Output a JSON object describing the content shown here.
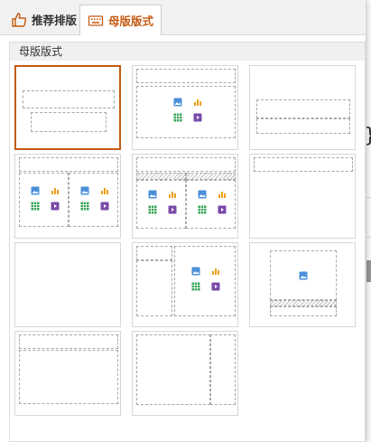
{
  "tabs": [
    {
      "label": "推荐排版",
      "icon": "thumbs-up-icon",
      "active": false
    },
    {
      "label": "母版版式",
      "icon": "keyboard-icon",
      "active": true
    }
  ],
  "section": {
    "title": "母版版式"
  },
  "layouts": [
    {
      "name": "title-slide",
      "selected": true
    },
    {
      "name": "title-and-content",
      "selected": false
    },
    {
      "name": "section-header",
      "selected": false
    },
    {
      "name": "two-content",
      "selected": false
    },
    {
      "name": "comparison",
      "selected": false
    },
    {
      "name": "title-only",
      "selected": false
    },
    {
      "name": "blank",
      "selected": false
    },
    {
      "name": "content-with-caption",
      "selected": false
    },
    {
      "name": "picture-with-caption",
      "selected": false
    },
    {
      "name": "title-and-vertical-text",
      "selected": false
    },
    {
      "name": "vertical-title-and-text",
      "selected": false
    }
  ],
  "colors": {
    "accent": "#c55a11",
    "picture_icon": "#4a8fd9",
    "chart_icon": "#f0a11b",
    "table_icon": "#3aa55a",
    "media_icon": "#7a4aa8"
  }
}
